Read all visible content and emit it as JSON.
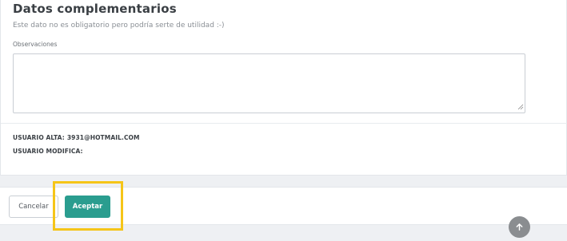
{
  "section": {
    "title": "Datos complementarios",
    "helper": "Este dato no es obligatorio pero podría serte de utilidad :-)"
  },
  "observaciones": {
    "label": "Observaciones",
    "value": ""
  },
  "meta": {
    "alta_label": "USUARIO ALTA:",
    "alta_value": "3931@HOTMAIL.COM",
    "modifica_label": "USUARIO MODIFICA:",
    "modifica_value": ""
  },
  "footer": {
    "cancel_label": "Cancelar",
    "accept_label": "Aceptar"
  },
  "colors": {
    "accent": "#2a9d8f",
    "highlight": "#f5c518",
    "scroll_button": "#8a8d90"
  },
  "icons": {
    "scroll_top": "arrow-up-icon",
    "resize": "resize-handle-icon"
  }
}
